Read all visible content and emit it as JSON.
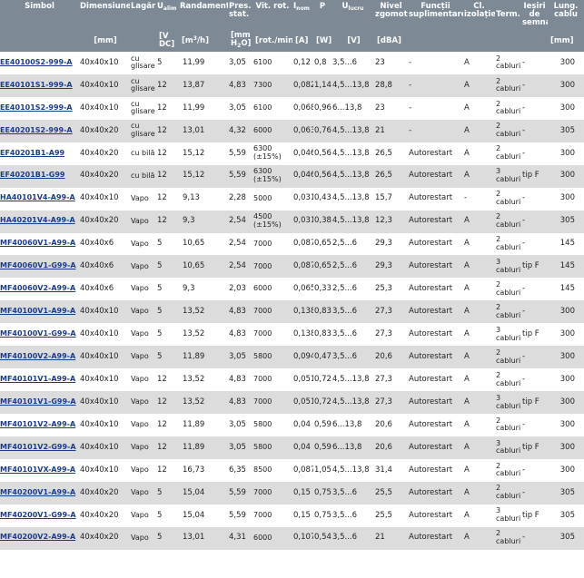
{
  "headers": {
    "simbol": "Simbol",
    "dimensiune": "Dimensiune",
    "lagar": "Lagăr",
    "ualim_main": "U",
    "ualim_sub": "alim",
    "randament": "Randament",
    "pres_stat": "Pres. stat.",
    "vit_rot": "Vit. rot.",
    "inom_main": "I",
    "inom_sub": "nom",
    "p": "P",
    "ulucru_main": "U",
    "ulucru_sub": "lucru",
    "nivel_zgomot": "Nivel zgomot",
    "functii": "Funcții suplimentare",
    "cl_izolatie": "Cl. izolație",
    "term": "Term.",
    "iesiri": "Ieșiri de semnal",
    "lung_cablu": "Lung. cablu"
  },
  "units": {
    "dimensiune": "[mm]",
    "ualim": "[V DC]",
    "randament_pre": "[m",
    "randament_sup": "3",
    "randament_post": "/h]",
    "pres_pre": "[mm H",
    "pres_sub": "2",
    "pres_post": "O]",
    "vit_rot": "[rot./min]",
    "inom": "[A]",
    "p": "[W]",
    "ulucru": "[V]",
    "nivel": "[dBA]",
    "lung": "[mm]"
  },
  "rows": [
    {
      "simbol": "EE40100S2-999-A",
      "dim": "40x40x10",
      "lagar": "cu glisare",
      "u": "5",
      "rand": "11,99",
      "pres": "3,05",
      "vit": "6100",
      "i": "0,12",
      "p": "0,8",
      "ul": "3,5...6",
      "niv": "23",
      "func": "-",
      "cl": "A",
      "term": "2 cabluri",
      "ies": "-",
      "lung": "300"
    },
    {
      "simbol": "EE40101S1-999-A",
      "dim": "40x40x10",
      "lagar": "cu glisare",
      "u": "12",
      "rand": "13,87",
      "pres": "4,83",
      "vit": "7300",
      "i": "0,082",
      "p": "1,14",
      "ul": "4,5...13,8",
      "niv": "28,8",
      "func": "-",
      "cl": "A",
      "term": "2 cabluri",
      "ies": "-",
      "lung": "300"
    },
    {
      "simbol": "EE40101S2-999-A",
      "dim": "40x40x10",
      "lagar": "cu glisare",
      "u": "12",
      "rand": "11,99",
      "pres": "3,05",
      "vit": "6100",
      "i": "0,068",
      "p": "0,96",
      "ul": "6...13,8",
      "niv": "23",
      "func": "-",
      "cl": "A",
      "term": "2 cabluri",
      "ies": "-",
      "lung": "300"
    },
    {
      "simbol": "EE40201S2-999-A",
      "dim": "40x40x20",
      "lagar": "cu glisare",
      "u": "12",
      "rand": "13,01",
      "pres": "4,32",
      "vit": "6000",
      "i": "0,063",
      "p": "0,76",
      "ul": "4,5...13,8",
      "niv": "21",
      "func": "-",
      "cl": "A",
      "term": "2 cabluri",
      "ies": "-",
      "lung": "305"
    },
    {
      "simbol": "EF40201B1-A99",
      "dim": "40x40x20",
      "lagar": "cu bilă",
      "u": "12",
      "rand": "15,12",
      "pres": "5,59",
      "vit": "6300 (±15%)",
      "i": "0,046",
      "p": "0,56",
      "ul": "4,5...13,8",
      "niv": "26,5",
      "func": "Autorestart",
      "cl": "A",
      "term": "2 cabluri",
      "ies": "-",
      "lung": "300"
    },
    {
      "simbol": "EF40201B1-G99",
      "dim": "40x40x20",
      "lagar": "cu bilă",
      "u": "12",
      "rand": "15,12",
      "pres": "5,59",
      "vit": "6300 (±15%)",
      "i": "0,046",
      "p": "0,56",
      "ul": "4,5...13,8",
      "niv": "26,5",
      "func": "Autorestart",
      "cl": "A",
      "term": "3 cabluri",
      "ies": "tip F",
      "lung": "300"
    },
    {
      "simbol": "HA40101V4-A99-A",
      "dim": "40x40x10",
      "lagar": "Vapo",
      "u": "12",
      "rand": "9,13",
      "pres": "2,28",
      "vit": "5000",
      "i": "0,031",
      "p": "0,43",
      "ul": "4,5...13,8",
      "niv": "15,7",
      "func": "Autorestart",
      "cl": "-",
      "term": "2 cabluri",
      "ies": "-",
      "lung": "300"
    },
    {
      "simbol": "HA40201V4-A99-A",
      "dim": "40x40x20",
      "lagar": "Vapo",
      "u": "12",
      "rand": "9,3",
      "pres": "2,54",
      "vit": "4500 (±15%)",
      "i": "0,031",
      "p": "0,38",
      "ul": "4,5...13,8",
      "niv": "12,3",
      "func": "Autorestart",
      "cl": "A",
      "term": "2 cabluri",
      "ies": "-",
      "lung": "305"
    },
    {
      "simbol": "MF40060V1-A99-A",
      "dim": "40x40x6",
      "lagar": "Vapo",
      "u": "5",
      "rand": "10,65",
      "pres": "2,54",
      "vit": "7000",
      "i": "0,087",
      "p": "0,65",
      "ul": "2,5...6",
      "niv": "29,3",
      "func": "Autorestart",
      "cl": "A",
      "term": "2 cabluri",
      "ies": "-",
      "lung": "145"
    },
    {
      "simbol": "MF40060V1-G99-A",
      "dim": "40x40x6",
      "lagar": "Vapo",
      "u": "5",
      "rand": "10,65",
      "pres": "2,54",
      "vit": "7000",
      "i": "0,087",
      "p": "0,65",
      "ul": "2,5...6",
      "niv": "29,3",
      "func": "Autorestart",
      "cl": "A",
      "term": "3 cabluri",
      "ies": "tip F",
      "lung": "145"
    },
    {
      "simbol": "MF40060V2-A99-A",
      "dim": "40x40x6",
      "lagar": "Vapo",
      "u": "5",
      "rand": "9,3",
      "pres": "2,03",
      "vit": "6000",
      "i": "0,065",
      "p": "0,33",
      "ul": "2,5...6",
      "niv": "25,3",
      "func": "Autorestart",
      "cl": "A",
      "term": "2 cabluri",
      "ies": "-",
      "lung": "145"
    },
    {
      "simbol": "MF40100V1-A99-A",
      "dim": "40x40x10",
      "lagar": "Vapo",
      "u": "5",
      "rand": "13,52",
      "pres": "4,83",
      "vit": "7000",
      "i": "0,138",
      "p": "0,83",
      "ul": "3,5...6",
      "niv": "27,3",
      "func": "Autorestart",
      "cl": "A",
      "term": "2 cabluri",
      "ies": "-",
      "lung": "300"
    },
    {
      "simbol": "MF40100V1-G99-A",
      "dim": "40x40x10",
      "lagar": "Vapo",
      "u": "5",
      "rand": "13,52",
      "pres": "4,83",
      "vit": "7000",
      "i": "0,138",
      "p": "0,83",
      "ul": "3,5...6",
      "niv": "27,3",
      "func": "Autorestart",
      "cl": "A",
      "term": "3 cabluri",
      "ies": "tip F",
      "lung": "300"
    },
    {
      "simbol": "MF40100V2-A99-A",
      "dim": "40x40x10",
      "lagar": "Vapo",
      "u": "5",
      "rand": "11,89",
      "pres": "3,05",
      "vit": "5800",
      "i": "0,094",
      "p": "0,47",
      "ul": "3,5...6",
      "niv": "20,6",
      "func": "Autorestart",
      "cl": "A",
      "term": "2 cabluri",
      "ies": "-",
      "lung": "300"
    },
    {
      "simbol": "MF40101V1-A99-A",
      "dim": "40x40x10",
      "lagar": "Vapo",
      "u": "12",
      "rand": "13,52",
      "pres": "4,83",
      "vit": "7000",
      "i": "0,051",
      "p": "0,72",
      "ul": "4,5...13,8",
      "niv": "27,3",
      "func": "Autorestart",
      "cl": "A",
      "term": "2 cabluri",
      "ies": "-",
      "lung": "300"
    },
    {
      "simbol": "MF40101V1-G99-A",
      "dim": "40x40x10",
      "lagar": "Vapo",
      "u": "12",
      "rand": "13,52",
      "pres": "4,83",
      "vit": "7000",
      "i": "0,051",
      "p": "0,72",
      "ul": "4,5...13,8",
      "niv": "27,3",
      "func": "Autorestart",
      "cl": "A",
      "term": "3 cabluri",
      "ies": "tip F",
      "lung": "300"
    },
    {
      "simbol": "MF40101V2-A99-A",
      "dim": "40x40x10",
      "lagar": "Vapo",
      "u": "12",
      "rand": "11,89",
      "pres": "3,05",
      "vit": "5800",
      "i": "0,04",
      "p": "0,59",
      "ul": "6...13,8",
      "niv": "20,6",
      "func": "Autorestart",
      "cl": "A",
      "term": "2 cabluri",
      "ies": "-",
      "lung": "300"
    },
    {
      "simbol": "MF40101V2-G99-A",
      "dim": "40x40x10",
      "lagar": "Vapo",
      "u": "12",
      "rand": "11,89",
      "pres": "3,05",
      "vit": "5800",
      "i": "0,04",
      "p": "0,59",
      "ul": "6...13,8",
      "niv": "20,6",
      "func": "Autorestart",
      "cl": "A",
      "term": "3 cabluri",
      "ies": "tip F",
      "lung": "300"
    },
    {
      "simbol": "MF40101VX-A99-A",
      "dim": "40x40x10",
      "lagar": "Vapo",
      "u": "12",
      "rand": "16,73",
      "pres": "6,35",
      "vit": "8500",
      "i": "0,087",
      "p": "1,05",
      "ul": "4,5...13,8",
      "niv": "31,4",
      "func": "Autorestart",
      "cl": "A",
      "term": "2 cabluri",
      "ies": "-",
      "lung": "300"
    },
    {
      "simbol": "MF40200V1-A99-A",
      "dim": "40x40x20",
      "lagar": "Vapo",
      "u": "5",
      "rand": "15,04",
      "pres": "5,59",
      "vit": "7000",
      "i": "0,15",
      "p": "0,75",
      "ul": "3,5...6",
      "niv": "25,5",
      "func": "Autorestart",
      "cl": "A",
      "term": "2 cabluri",
      "ies": "-",
      "lung": "305"
    },
    {
      "simbol": "MF40200V1-G99-A",
      "dim": "40x40x20",
      "lagar": "Vapo",
      "u": "5",
      "rand": "15,04",
      "pres": "5,59",
      "vit": "7000",
      "i": "0,15",
      "p": "0,75",
      "ul": "3,5...6",
      "niv": "25,5",
      "func": "Autorestart",
      "cl": "A",
      "term": "3 cabluri",
      "ies": "tip F",
      "lung": "305"
    },
    {
      "simbol": "MF40200V2-A99-A",
      "dim": "40x40x20",
      "lagar": "Vapo",
      "u": "5",
      "rand": "13,01",
      "pres": "4,31",
      "vit": "6000",
      "i": "0,107",
      "p": "0,54",
      "ul": "3,5...6",
      "niv": "21",
      "func": "Autorestart",
      "cl": "A",
      "term": "2 cabluri",
      "ies": "-",
      "lung": "305"
    }
  ],
  "colors": {
    "header_bg": "#7d8a96",
    "header_text": "#ffffff",
    "row_alt_bg": "#dcdcdc",
    "link": "#1a3c8c"
  }
}
